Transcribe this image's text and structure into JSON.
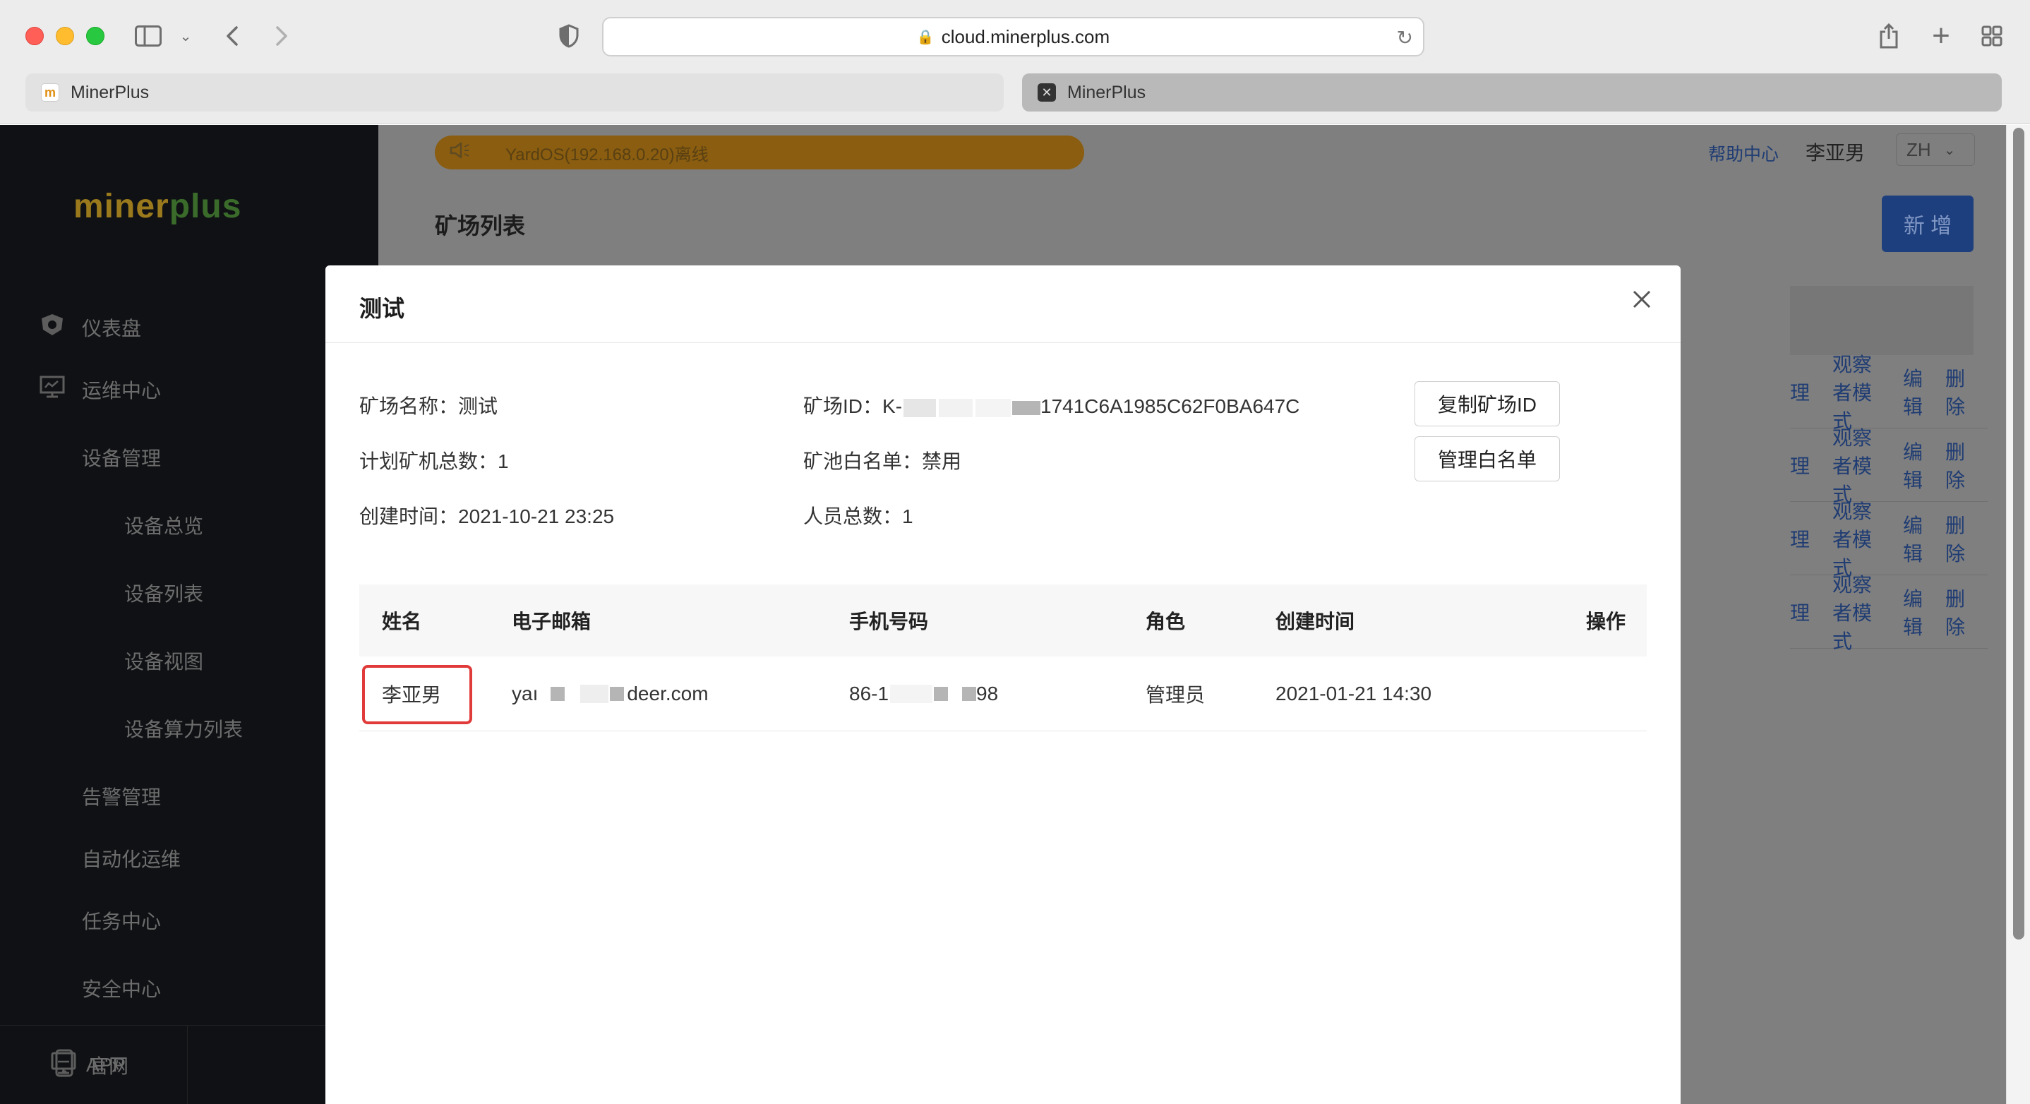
{
  "browser": {
    "url": "cloud.minerplus.com",
    "tabs": [
      {
        "title": "MinerPlus",
        "favicon": "m"
      },
      {
        "title": "MinerPlus",
        "favicon": "x"
      }
    ]
  },
  "sidebar": {
    "logo_part1": "miner",
    "logo_part2": "plus",
    "items": [
      {
        "label": "仪表盘",
        "icon": "dashboard-icon"
      },
      {
        "label": "运维中心",
        "icon": "monitor-icon"
      },
      {
        "label": "设备管理"
      },
      {
        "label": "设备总览"
      },
      {
        "label": "设备列表"
      },
      {
        "label": "设备视图"
      },
      {
        "label": "设备算力列表"
      },
      {
        "label": "告警管理"
      },
      {
        "label": "自动化运维"
      },
      {
        "label": "任务中心"
      },
      {
        "label": "安全中心"
      }
    ],
    "bottom": {
      "website": "官网",
      "app": "APP"
    }
  },
  "header": {
    "notice": "YardOS(192.168.0.20)离线",
    "help": "帮助中心",
    "username": "李亚男",
    "lang": "ZH",
    "page_title": "矿场列表",
    "add_button": "新 增"
  },
  "background_rows": {
    "actions": [
      "理",
      "观察者模式",
      "编辑",
      "删除"
    ]
  },
  "modal": {
    "title": "测试",
    "farm_name_label": "矿场名称：",
    "farm_name": "测试",
    "farm_id_label": "矿场ID：",
    "farm_id_prefix": "K-",
    "farm_id_suffix": "1741C6A1985C62F0BA647C",
    "copy_id_button": "复制矿场ID",
    "planned_label": "计划矿机总数：",
    "planned": "1",
    "whitelist_label": "矿池白名单：",
    "whitelist": "禁用",
    "manage_whitelist_button": "管理白名单",
    "created_label": "创建时间：",
    "created": "2021-10-21 23:25",
    "members_label": "人员总数：",
    "members": "1",
    "table": {
      "headers": [
        "姓名",
        "电子邮箱",
        "手机号码",
        "角色",
        "创建时间",
        "操作"
      ],
      "rows": [
        {
          "name": "李亚男",
          "email_prefix": "yaı",
          "email_suffix": "deer.com",
          "phone_prefix": "86-1",
          "phone_suffix": "98",
          "role": "管理员",
          "created": "2021-01-21 14:30"
        }
      ]
    }
  }
}
